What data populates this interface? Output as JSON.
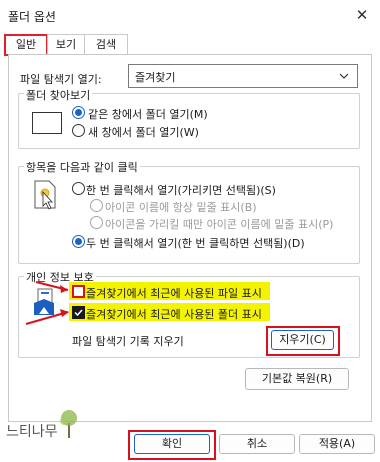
{
  "window": {
    "title": "폴더 옵션",
    "close_symbol": "✕"
  },
  "tabs": [
    {
      "label": "일반"
    },
    {
      "label": "보기"
    },
    {
      "label": "검색"
    }
  ],
  "browse": {
    "label": "파일 탐색기 열기:",
    "value": "즐겨찾기"
  },
  "browse_group": {
    "title": "폴더 찾아보기",
    "options": [
      {
        "label": "같은 창에서 폴더 열기(M)"
      },
      {
        "label": "새 창에서 폴더 열기(W)"
      }
    ]
  },
  "click_group": {
    "title": "항목을 다음과 같이 클릭",
    "options": [
      {
        "label": "한 번 클릭해서 열기(가리키면 선택됨)(S)"
      },
      {
        "label": "아이콘 이름에 항상 밑줄 표시(B)"
      },
      {
        "label": "아이콘을 가리킬 때만 아이콘 이름에 밑줄 표시(P)"
      },
      {
        "label": "두 번 클릭해서 열기(한 번 클릭하면 선택됨)(D)"
      }
    ]
  },
  "privacy_group": {
    "title": "개인 정보 보호",
    "recent_files": {
      "label": "즐겨찾기에서 최근에 사용된 파일 표시",
      "checked": false
    },
    "frequent_folders": {
      "label": "즐겨찾기에서 최근에 사용된 폴더 표시",
      "checked": true
    },
    "clear_label": "파일 탐색기 기록 지우기",
    "clear_button": "지우기(C)"
  },
  "restore_button": "기본값 복원(R)",
  "footer": {
    "ok": "확인",
    "cancel": "취소",
    "apply": "적용(A)"
  },
  "watermark": "느티나무",
  "colors": {
    "highlight": "#f5f400",
    "annotation": "#d4131e",
    "accent": "#1d62c8"
  }
}
